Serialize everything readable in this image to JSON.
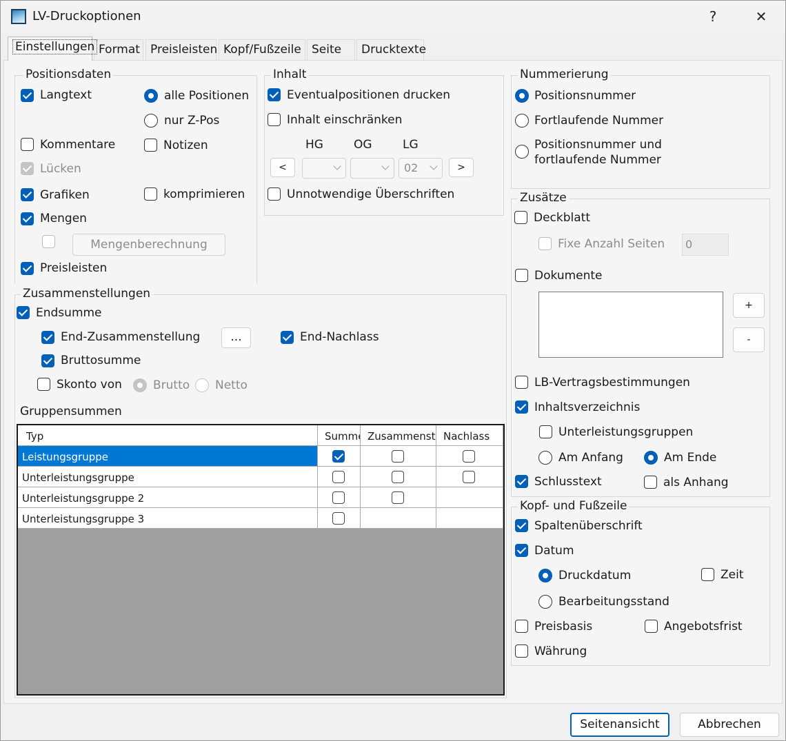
{
  "window": {
    "title": "LV-Druckoptionen",
    "help": "?",
    "close": "✕"
  },
  "tabs": [
    "Einstellungen",
    "Format",
    "Preisleisten",
    "Kopf/Fußzeile",
    "Seite",
    "Drucktexte"
  ],
  "positionsdaten": {
    "legend": "Positionsdaten",
    "langtext": "Langtext",
    "alle_positionen": "alle Positionen",
    "nur_zpos": "nur Z-Pos",
    "kommentare": "Kommentare",
    "notizen": "Notizen",
    "luecken": "Lücken",
    "grafiken": "Grafiken",
    "komprimieren": "komprimieren",
    "mengen": "Mengen",
    "mengenberechnung": "Mengenberechnung",
    "preisleisten": "Preisleisten"
  },
  "inhalt": {
    "legend": "Inhalt",
    "eventualpositionen": "Eventualpositionen drucken",
    "einschraenken": "Inhalt einschränken",
    "hg": "HG",
    "og": "OG",
    "lg": "LG",
    "prev": "<",
    "next": ">",
    "lg_value": "02",
    "unnotwendige": "Unnotwendige Überschriften"
  },
  "zusammenstellungen": {
    "legend": "Zusammenstellungen",
    "endsumme": "Endsumme",
    "end_zusammenstellung": "End-Zusammenstellung",
    "dots": "...",
    "end_nachlass": "End-Nachlass",
    "bruttosumme": "Bruttosumme",
    "skonto_von": "Skonto von",
    "brutto": "Brutto",
    "netto": "Netto",
    "gruppensummen": "Gruppensummen"
  },
  "grid": {
    "headers": [
      "Typ",
      "Summe",
      "Zusammenst.",
      "Nachlass"
    ],
    "rows": [
      {
        "typ": "Leistungsgruppe",
        "summe": true,
        "zusammenst": false,
        "nachlass": false,
        "has_z": true,
        "has_n": true
      },
      {
        "typ": "Unterleistungsgruppe",
        "summe": false,
        "zusammenst": false,
        "nachlass": false,
        "has_z": true,
        "has_n": true
      },
      {
        "typ": "Unterleistungsgruppe 2",
        "summe": false,
        "zusammenst": false,
        "nachlass": false,
        "has_z": true,
        "has_n": false
      },
      {
        "typ": "Unterleistungsgruppe 3",
        "summe": false,
        "zusammenst": false,
        "nachlass": false,
        "has_z": false,
        "has_n": false
      }
    ]
  },
  "nummerierung": {
    "legend": "Nummerierung",
    "positionsnummer": "Positionsnummer",
    "fortlaufende": "Fortlaufende Nummer",
    "beide_1": "Positionsnummer und",
    "beide_2": "fortlaufende Nummer"
  },
  "zusaetze": {
    "legend": "Zusätze",
    "deckblatt": "Deckblatt",
    "fixe_anzahl": "Fixe Anzahl Seiten",
    "fixe_value": "0",
    "dokumente": "Dokumente",
    "plus": "+",
    "minus": "-",
    "lb_vertrag": "LB-Vertragsbestimmungen",
    "inhaltsverzeichnis": "Inhaltsverzeichnis",
    "unterleistungsgruppen": "Unterleistungsgruppen",
    "am_anfang": "Am Anfang",
    "am_ende": "Am Ende",
    "schlusstext": "Schlusstext",
    "als_anhang": "als Anhang"
  },
  "kopf_fuss": {
    "legend": "Kopf- und Fußzeile",
    "spaltenueberschrift": "Spaltenüberschrift",
    "datum": "Datum",
    "druckdatum": "Druckdatum",
    "zeit": "Zeit",
    "bearbeitungsstand": "Bearbeitungsstand",
    "preisbasis": "Preisbasis",
    "angebotsfrist": "Angebotsfrist",
    "waehrung": "Währung"
  },
  "footer": {
    "seitenansicht": "Seitenansicht",
    "abbrechen": "Abbrechen"
  },
  "colors": {
    "accent": "#005fb8",
    "selection": "#0078d4",
    "grid_empty": "#a0a0a0"
  }
}
